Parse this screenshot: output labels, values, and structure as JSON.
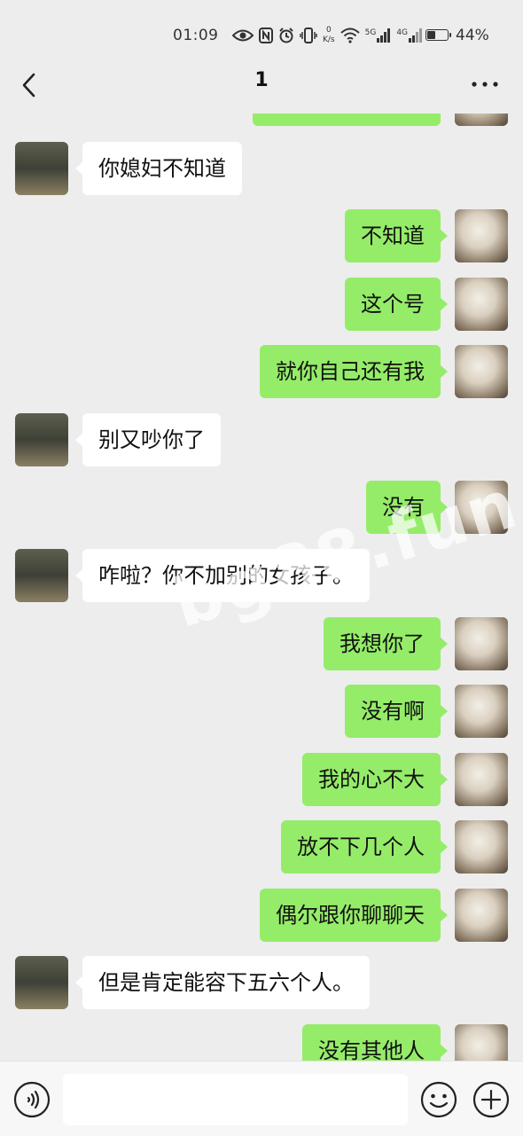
{
  "status_bar": {
    "time": "01:09",
    "net_speed_value": "0",
    "net_speed_unit": "K/s",
    "signal1_label": "5G",
    "signal2_label": "4G",
    "battery_percent": "44%",
    "battery_level": 0.44
  },
  "header": {
    "title": "1"
  },
  "messages": [
    {
      "side": "right",
      "text": ""
    },
    {
      "side": "left",
      "text": "你媳妇不知道"
    },
    {
      "side": "right",
      "text": "不知道"
    },
    {
      "side": "right",
      "text": "这个号"
    },
    {
      "side": "right",
      "text": "就你自己还有我"
    },
    {
      "side": "left",
      "text": "别又吵你了"
    },
    {
      "side": "right",
      "text": "没有"
    },
    {
      "side": "left",
      "text": "咋啦？你不加别的女孩子。"
    },
    {
      "side": "right",
      "text": "我想你了"
    },
    {
      "side": "right",
      "text": "没有啊"
    },
    {
      "side": "right",
      "text": "我的心不大"
    },
    {
      "side": "right",
      "text": "放不下几个人"
    },
    {
      "side": "right",
      "text": "偶尔跟你聊聊天"
    },
    {
      "side": "left",
      "text": "但是肯定能容下五六个人。"
    },
    {
      "side": "right",
      "text": "没有其他人"
    }
  ],
  "watermark": "bg88.fun",
  "input_bar": {
    "text_value": "",
    "voice_icon": "voice-icon",
    "emoji_icon": "emoji-icon",
    "plus_icon": "plus-icon"
  },
  "colors": {
    "background": "#ededed",
    "sent_bubble": "#95ec69",
    "received_bubble": "#ffffff"
  }
}
